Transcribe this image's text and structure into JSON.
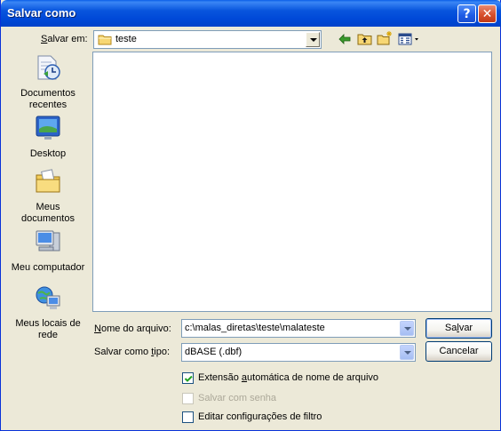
{
  "window": {
    "title": "Salvar como"
  },
  "titlebar": {
    "help_icon": "?",
    "close_icon": "✕"
  },
  "save_in": {
    "label_pre": "",
    "label_accel": "S",
    "label_post": "alvar em:",
    "value": "teste"
  },
  "places": [
    {
      "label_line1": "Documentos",
      "label_line2": "recentes",
      "icon": "recent-documents-icon"
    },
    {
      "label_line1": "Desktop",
      "label_line2": "",
      "icon": "desktop-icon"
    },
    {
      "label_line1": "Meus",
      "label_line2": "documentos",
      "icon": "my-documents-icon"
    },
    {
      "label_line1": "Meu computador",
      "label_line2": "",
      "icon": "my-computer-icon"
    },
    {
      "label_line1": "Meus locais de",
      "label_line2": "rede",
      "icon": "network-places-icon"
    }
  ],
  "filename": {
    "label_accel": "N",
    "label_post": "ome do arquivo:",
    "value": "c:\\malas_diretas\\teste\\malateste"
  },
  "filetype": {
    "label_pre": "Salvar como ",
    "label_accel": "t",
    "label_post": "ipo:",
    "value": "dBASE (.dbf)"
  },
  "buttons": {
    "save_pre": "Sa",
    "save_accel": "l",
    "save_post": "var",
    "cancel": "Cancelar"
  },
  "options": {
    "auto_ext": {
      "pre": "Extensão ",
      "accel": "a",
      "post": "utomática de nome de arquivo",
      "checked": true,
      "enabled": true
    },
    "password": {
      "pre": "Salvar com senha",
      "accel": "",
      "post": "",
      "checked": false,
      "enabled": false
    },
    "filter": {
      "pre": "Editar configurações de filtro",
      "accel": "",
      "post": "",
      "checked": false,
      "enabled": true
    }
  }
}
